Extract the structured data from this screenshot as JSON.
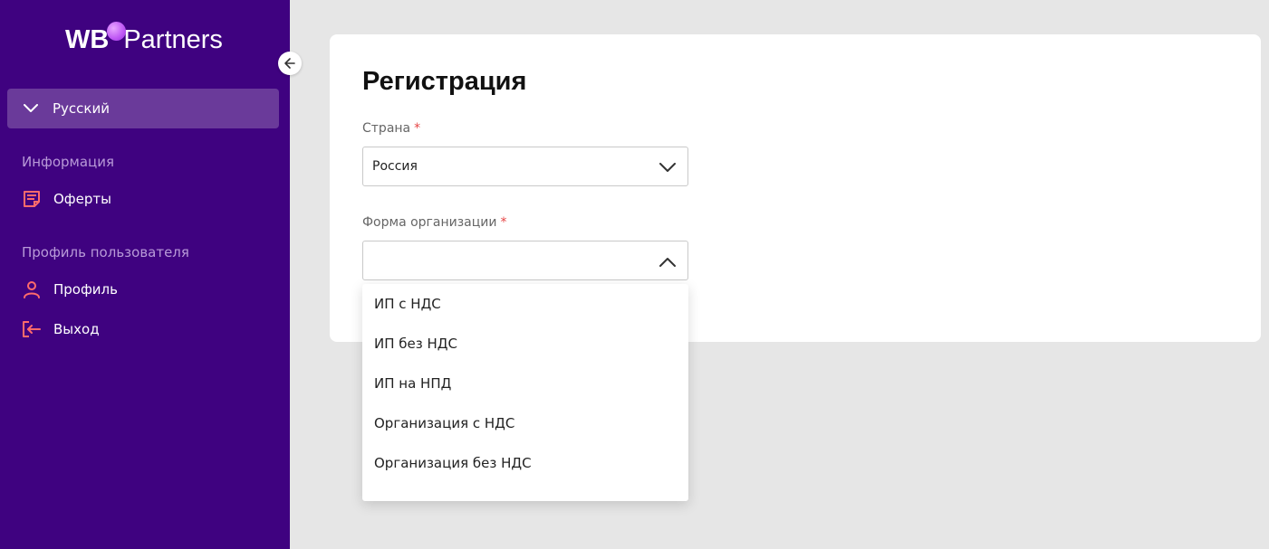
{
  "brand": {
    "left": "WB",
    "right": "Partners"
  },
  "language": {
    "selected": "Русский"
  },
  "sidebar": {
    "sections": [
      {
        "title": "Информация",
        "items": [
          {
            "label": "Оферты",
            "icon": "document-icon"
          }
        ]
      },
      {
        "title": "Профиль пользователя",
        "items": [
          {
            "label": "Профиль",
            "icon": "user-icon"
          },
          {
            "label": "Выход",
            "icon": "logout-icon"
          }
        ]
      }
    ]
  },
  "form": {
    "title": "Регистрация",
    "country": {
      "label": "Страна",
      "required_mark": "*",
      "value": "Россия"
    },
    "org_form": {
      "label": "Форма организации",
      "required_mark": "*",
      "value": ""
    }
  },
  "org_options": [
    "ИП с НДС",
    "ИП без НДС",
    "ИП на НПД",
    "Организация с НДС",
    "Организация без НДС"
  ],
  "colors": {
    "sidebar": "#3f0280",
    "accent_icon": "#ff6b6b",
    "required": "#e64545"
  }
}
